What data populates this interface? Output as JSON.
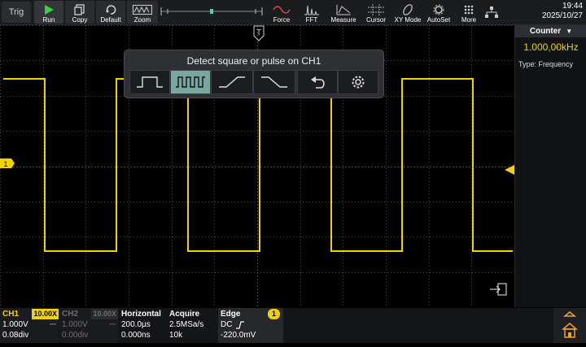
{
  "toolbar": {
    "trig": "Trig",
    "buttons": [
      {
        "label": "Run",
        "icon": "play-icon"
      },
      {
        "label": "Copy",
        "icon": "copy-icon"
      },
      {
        "label": "Default",
        "icon": "reset-icon"
      },
      {
        "label": "Zoom",
        "icon": "zoom-icon"
      },
      {
        "label": "Force",
        "icon": "force-wave-icon"
      },
      {
        "label": "FFT",
        "icon": "fft-icon"
      },
      {
        "label": "Measure",
        "icon": "measure-icon"
      },
      {
        "label": "Cursor",
        "icon": "cursor-icon"
      },
      {
        "label": "XY Mode",
        "icon": "xy-mode-icon"
      },
      {
        "label": "AutoSet",
        "icon": "autoset-icon"
      },
      {
        "label": "More",
        "icon": "more-icon"
      }
    ],
    "time": "19:44",
    "date": "2025/10/27"
  },
  "popup": {
    "title": "Detect square or pulse on CH1",
    "options": [
      "pulse-icon",
      "square-wave-icon",
      "rising-edge-icon",
      "falling-edge-icon",
      "undo-icon",
      "settings-icon"
    ],
    "selected_index": 1
  },
  "counter": {
    "header": "Counter",
    "value": "1.000,00kHz",
    "type": "Type: Frequency"
  },
  "ch1": {
    "label": "CH1",
    "probe": "10.00X",
    "scale": "1.000V",
    "coupling": "⎓",
    "offset": "0.08div"
  },
  "ch2": {
    "label": "CH2",
    "probe": "10.00X",
    "scale": "1.000V",
    "coupling": "⎓",
    "offset": "0.00div"
  },
  "horizontal": {
    "label": "Horizontal",
    "timebase": "200.0µs",
    "position": "0.000ns"
  },
  "acquire": {
    "label": "Acquire",
    "rate": "2.5MSa/s",
    "depth": "10k"
  },
  "trigger": {
    "label": "Edge",
    "channel": "1",
    "coupling": "DC",
    "level": "-220.0mV"
  },
  "markers": {
    "ch1_marker": "1",
    "trigger_marker": "T"
  },
  "colors": {
    "ch1": "#f2d200",
    "ch2": "#9a9a9a",
    "accent": "#7aa6a0",
    "grid": "#3a3a3a"
  }
}
